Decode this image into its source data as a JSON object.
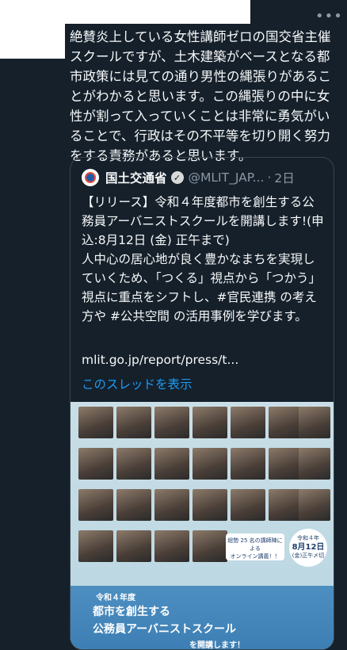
{
  "tweet": {
    "text": "絶賛炎上している女性講師ゼロの国交省主催スクールですが、土木建築がベースとなる都市政策には見ての通り男性の縄張りがあることがわかると思います。この縄張りの中に女性が割って入っていくことは非常に勇気がいることで、行政はその不平等を切り開く努力をする責務があると思います。"
  },
  "quote": {
    "name": "国土交通省",
    "handle": "@MLIT_JAP...",
    "time": "2日",
    "text": "【リリース】令和４年度都市を創生する公務員アーバニストスクールを開講します!(申込:8月12日 (金) 正午まで)\n人中心の居心地が良く豊かなまちを実現していくため、「つくる」視点から「つかう」視点に重点をシフトし、#官民連携 の考え方や #公共空間 の活用事例を学びます。",
    "link": "mlit.go.jp/report/press/t...",
    "thread": "このスレッドを表示"
  },
  "flyer": {
    "count_text": "総勢 25 名の講師陣による",
    "online_text": "オンライン講義！！",
    "date_top": "令和４年",
    "date_main": "8月12日",
    "date_sub": "(金)正午〆切",
    "title_line1": "令和４年度",
    "title_line2": "都市を創生する",
    "title_line3": "公務員アーバニストスクール",
    "title_line4": "を開講します！"
  },
  "icons": {
    "more": "more-icon",
    "verified": "verified-badge-icon",
    "logo": "mlit-logo-icon"
  },
  "colors": {
    "background": "#15202b",
    "link": "#1d9bf0",
    "muted": "#8b98a5"
  }
}
